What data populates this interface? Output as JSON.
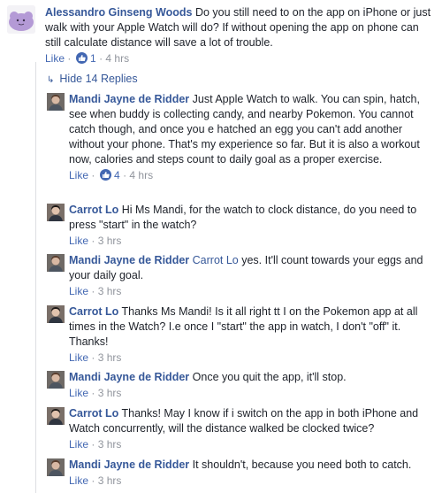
{
  "top_comment": {
    "author": "Alessandro Ginseng Woods",
    "text": "Do you still need to on the app on iPhone or just walk with your Apple Watch will do? If without opening the app on phone can still calculate distance will save a lot of trouble.",
    "like_label": "Like",
    "sep": "·",
    "like_count": "1",
    "time": "4 hrs"
  },
  "hide_replies_label": "Hide 14 Replies",
  "replies": [
    {
      "author": "Mandi Jayne de Ridder",
      "text": "Just Apple Watch to walk. You can spin, hatch, see when buddy is collecting candy, and nearby Pokemon. You cannot catch though, and once you e hatched an egg you can't add another without your phone. That's my experience so far. But it is also a workout now, calories and steps count to daily goal as a proper exercise.",
      "like_label": "Like",
      "sep": "·",
      "like_count": "4",
      "time": "4 hrs"
    },
    {
      "author": "Carrot Lo",
      "text": "Hi Ms Mandi, for the watch to clock distance, do you need to press \"start\" in the watch?",
      "like_label": "Like",
      "sep": "·",
      "time": "3 hrs"
    },
    {
      "author": "Mandi Jayne de Ridder",
      "mention": "Carrot Lo",
      "text": "yes. It'll count towards your eggs and your daily goal.",
      "like_label": "Like",
      "sep": "·",
      "time": "3 hrs"
    },
    {
      "author": "Carrot Lo",
      "text": "Thanks Ms Mandi! Is it all right tt I on the Pokemon app at all times in the Watch? I.e once I \"start\" the app in watch, I don't \"off\" it. Thanks!",
      "like_label": "Like",
      "sep": "·",
      "time": "3 hrs"
    },
    {
      "author": "Mandi Jayne de Ridder",
      "text": "Once you quit the app, it'll stop.",
      "like_label": "Like",
      "sep": "·",
      "time": "3 hrs"
    },
    {
      "author": "Carrot Lo",
      "text": "Thanks! May I know if i switch on the app in both iPhone and Watch concurrently, will the distance walked be clocked twice?",
      "like_label": "Like",
      "sep": "·",
      "time": "3 hrs"
    },
    {
      "author": "Mandi Jayne de Ridder",
      "text": "It shouldn't, because you need both to catch.",
      "like_label": "Like",
      "sep": "·",
      "time": "3 hrs"
    }
  ],
  "icons": {
    "like_badge": "thumbs-up-icon",
    "arrow": "reply-arrow-icon",
    "colors": {
      "link": "#365899",
      "like_blue": "#4267b2",
      "meta": "#90949c"
    }
  }
}
